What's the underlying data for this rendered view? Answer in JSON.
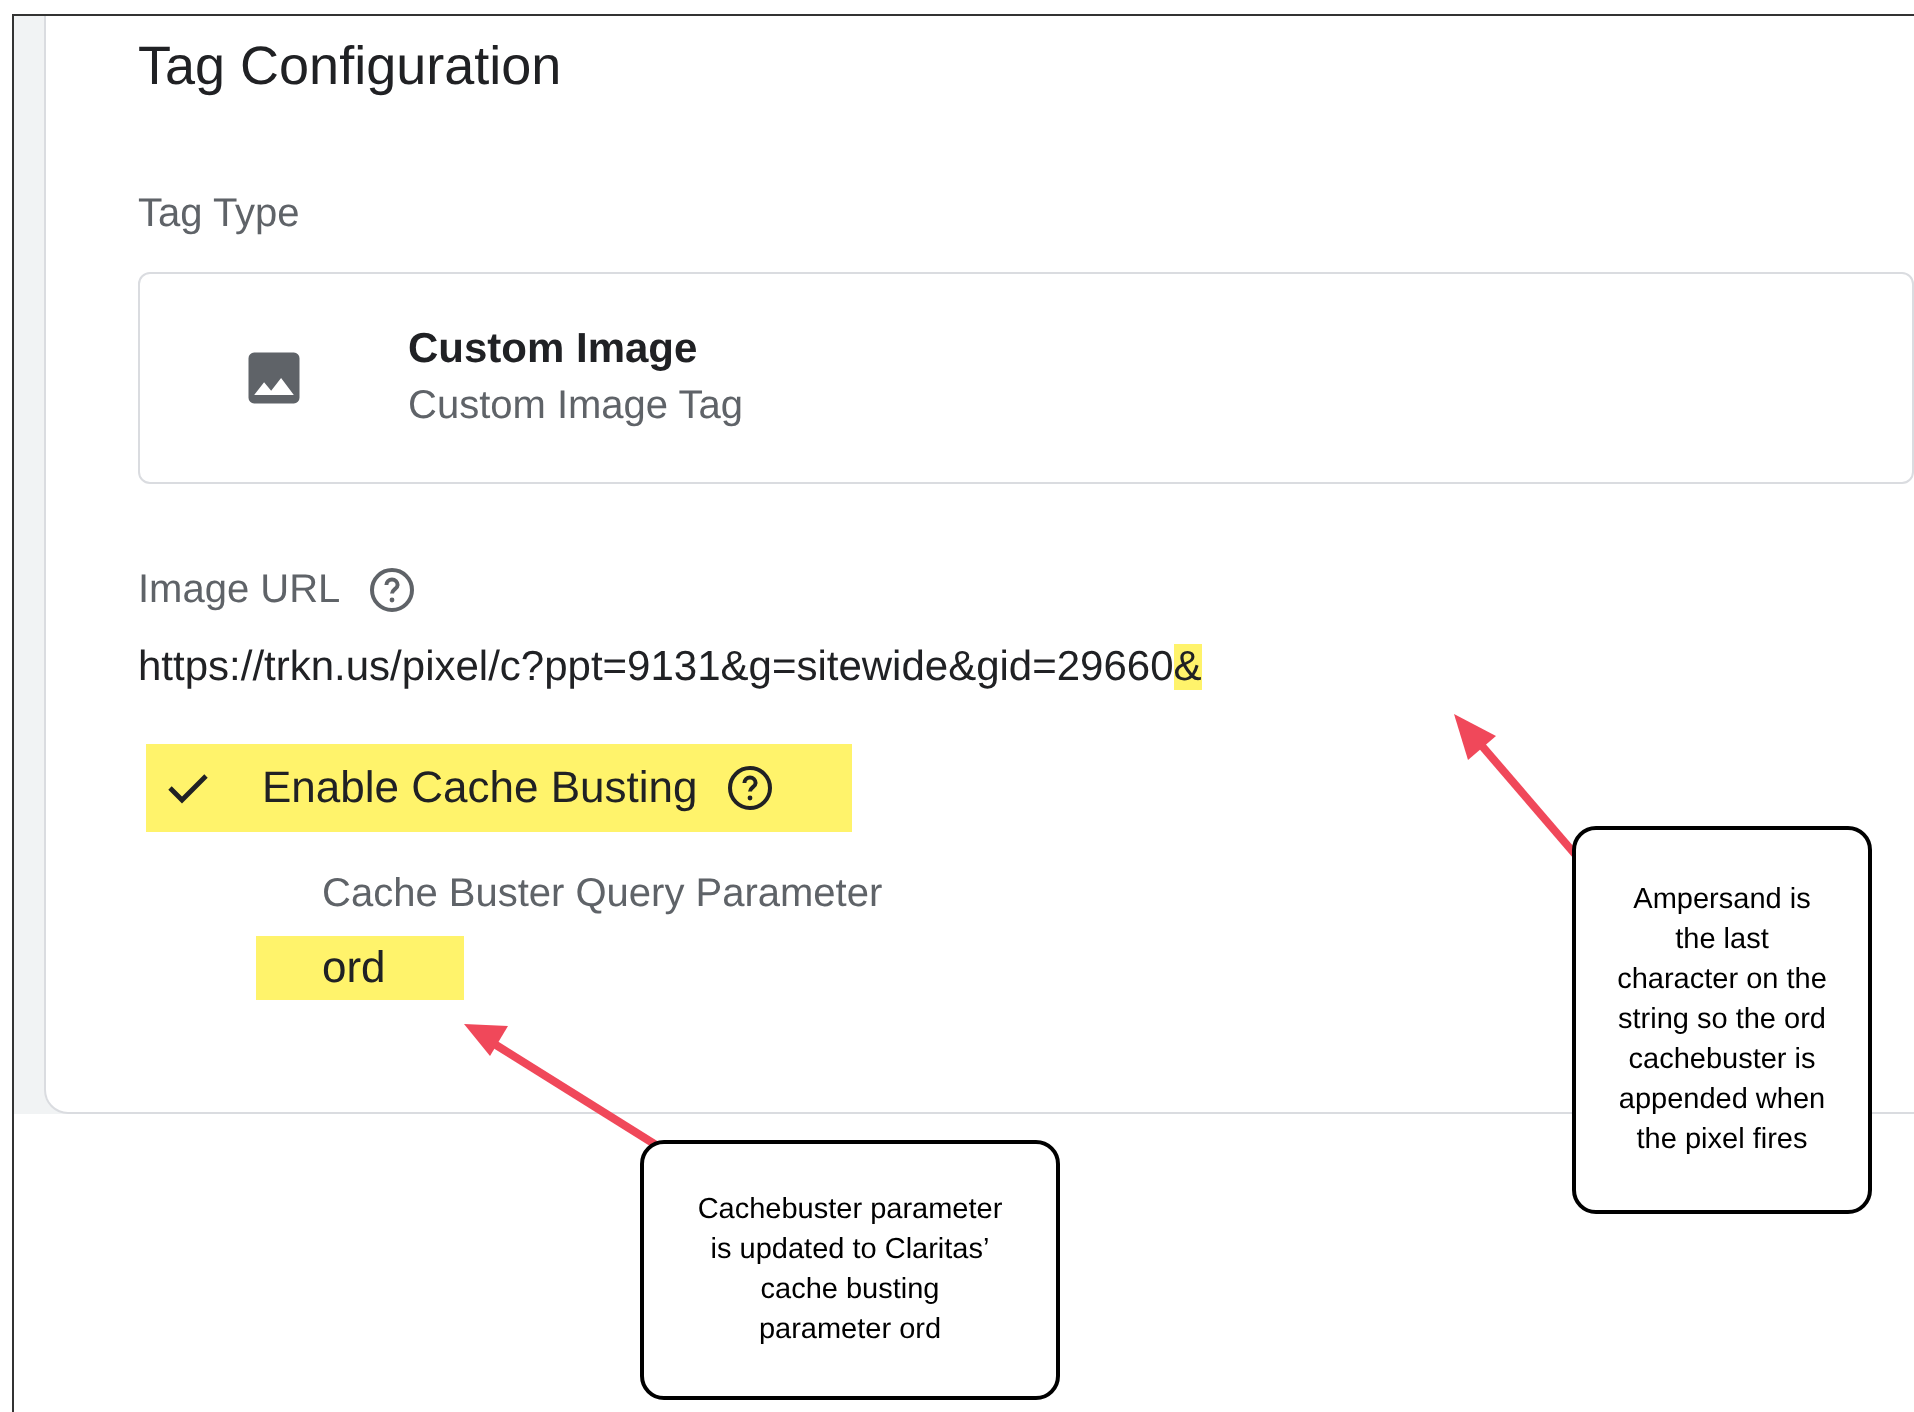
{
  "title": "Tag Configuration",
  "tag_type": {
    "label": "Tag Type",
    "name": "Custom Image",
    "description": "Custom Image Tag"
  },
  "image_url": {
    "label": "Image URL",
    "parts": [
      {
        "text": "https://trkn.us/pixel/c?ppt=9131&g=sitewide&gid=29660",
        "highlighted": false
      },
      {
        "text": "&",
        "highlighted": true
      }
    ]
  },
  "cache_busting": {
    "label": "Enable Cache Busting",
    "checked": true,
    "highlighted": true
  },
  "cache_buster_param": {
    "label": "Cache Buster Query Parameter",
    "value": "ord",
    "highlighted": true
  },
  "callouts": [
    {
      "text": "Ampersand is the last character on the string so the ord cachebuster is appended when the pixel fires"
    },
    {
      "text": "Cachebuster parameter is updated to Claritas’ cache busting parameter ord"
    }
  ]
}
